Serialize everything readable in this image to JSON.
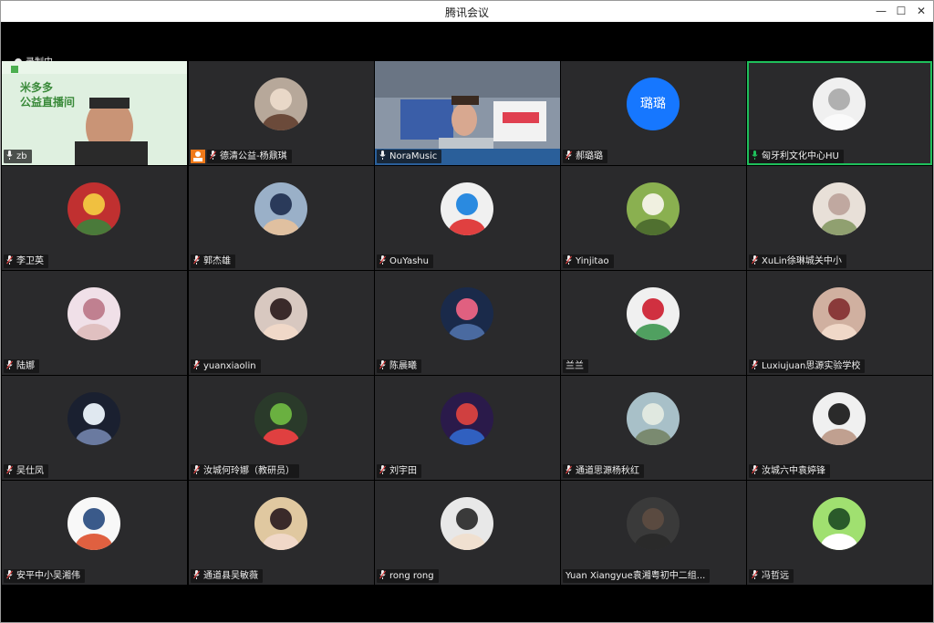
{
  "window": {
    "title": "腾讯会议"
  },
  "recording": {
    "label": "录制中"
  },
  "participants": [
    {
      "name": "zb",
      "mic": "on",
      "video": "banner",
      "banner_title_1": "米多多",
      "banner_title_2": "公益直播间"
    },
    {
      "name": "德清公益-杨鼐琪",
      "mic": "muted"
    },
    {
      "name": "NoraMusic",
      "mic": "on",
      "video": "room"
    },
    {
      "name": "郝璐璐",
      "mic": "muted",
      "text_avatar": "璐璐"
    },
    {
      "name": "匈牙利文化中心HU",
      "mic": "speaking",
      "active": true
    },
    {
      "name": "李卫英",
      "mic": "muted"
    },
    {
      "name": "郭杰雄",
      "mic": "muted"
    },
    {
      "name": "OuYashu",
      "mic": "muted"
    },
    {
      "name": "Yinjitao",
      "mic": "muted"
    },
    {
      "name": "XuLin徐琳城关中小",
      "mic": "muted"
    },
    {
      "name": "陆娜",
      "mic": "muted"
    },
    {
      "name": "yuanxiaolin",
      "mic": "muted"
    },
    {
      "name": "陈晨曦",
      "mic": "muted"
    },
    {
      "name": "兰兰",
      "mic": "none"
    },
    {
      "name": "Luxiujuan思源实验学校",
      "mic": "muted"
    },
    {
      "name": "吴仕凤",
      "mic": "muted"
    },
    {
      "name": "汝城何玲娜（教研员）",
      "mic": "muted"
    },
    {
      "name": "刘宇田",
      "mic": "muted"
    },
    {
      "name": "通道思源杨秋红",
      "mic": "muted"
    },
    {
      "name": "汝城六中袁婷锋",
      "mic": "muted"
    },
    {
      "name": "安平中小吴湘伟",
      "mic": "muted"
    },
    {
      "name": "通道县吴敏薇",
      "mic": "muted"
    },
    {
      "name": "rong rong",
      "mic": "muted"
    },
    {
      "name": "Yuan Xiangyue袁湘粤初中二组...",
      "mic": "none"
    },
    {
      "name": "冯哲远",
      "mic": "muted"
    }
  ],
  "colors": {
    "accent": "#1fbf5b",
    "tile_bg": "#2a2a2c",
    "text_avatar_bg": "#1677ff",
    "share_badge": "#f07a1a",
    "muted_mic": "#e04040"
  },
  "icons": {
    "minimize": "minimize-icon",
    "maximize": "maximize-icon",
    "close": "close-icon",
    "mic": "microphone-icon",
    "muted": "mic-muted-icon"
  }
}
